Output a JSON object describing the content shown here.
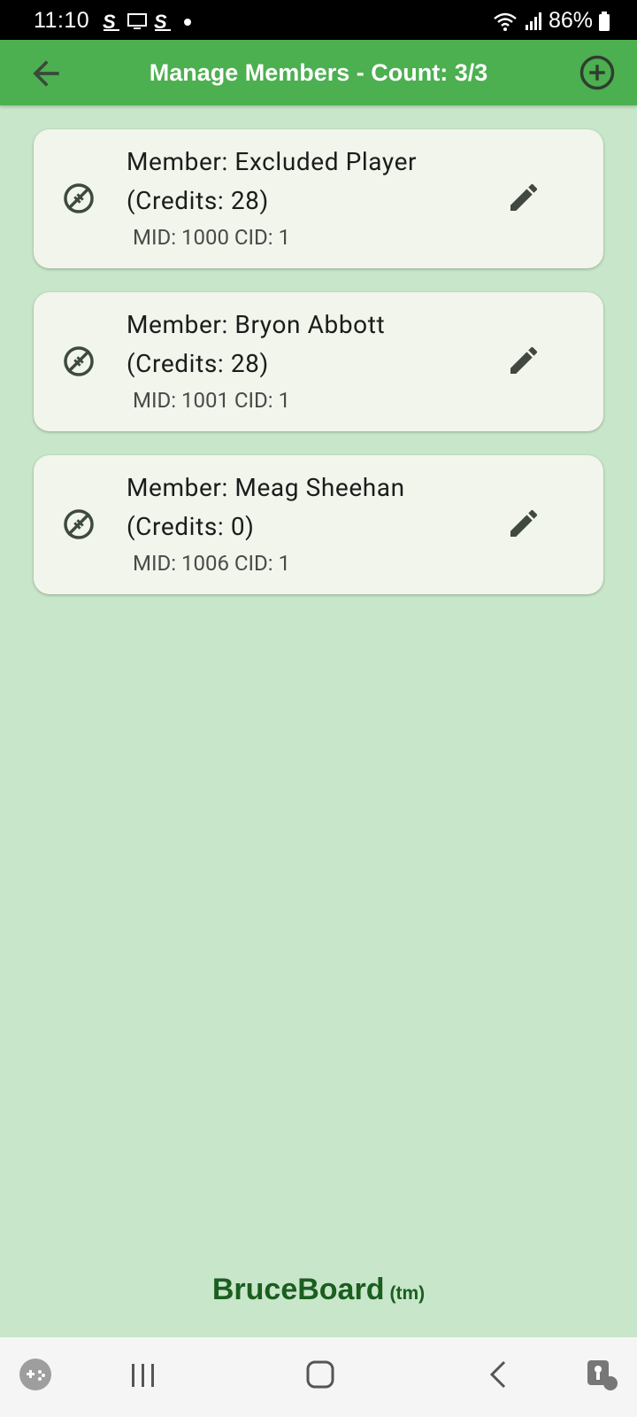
{
  "status_bar": {
    "time": "11:10",
    "battery": "86%"
  },
  "app_bar": {
    "title": "Manage Members - Count: 3/3",
    "color": "#4caf50"
  },
  "members": [
    {
      "name_line": "Member: Excluded Player",
      "credits_line": "(Credits: 28)",
      "ids_line": "MID: 1000 CID: 1"
    },
    {
      "name_line": "Member: Bryon Abbott",
      "credits_line": "(Credits: 28)",
      "ids_line": "MID: 1001 CID: 1"
    },
    {
      "name_line": "Member: Meag Sheehan",
      "credits_line": "(Credits: 0)",
      "ids_line": "MID: 1006 CID: 1"
    }
  ],
  "brand": {
    "name": "BruceBoard",
    "tm": "(tm)",
    "color": "#1b5e20"
  },
  "icons": {
    "back": "arrow-left-icon",
    "add": "add-circle-icon",
    "member": "football-icon",
    "edit": "pencil-icon"
  },
  "colors": {
    "background": "#c8e6c9",
    "card": "#f1f5ec"
  }
}
